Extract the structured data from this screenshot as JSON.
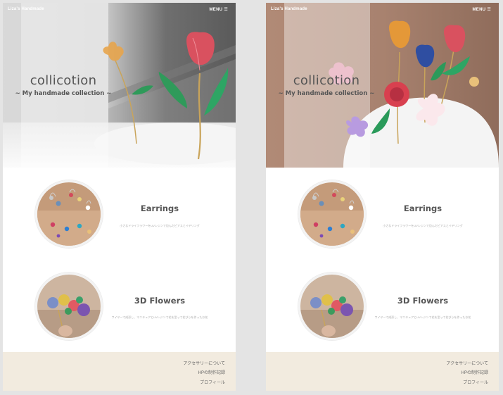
{
  "site_title": "Liza's Handmade",
  "menu_label": "MENU ☰",
  "hero": {
    "title": "collicotion",
    "subtitle": "~ My handmade collection ~"
  },
  "sections": [
    {
      "title": "Earrings",
      "description": "小さなドライフラワーをUVレジンで包んだピアスとイヤリング"
    },
    {
      "title": "3D Flowers",
      "description": "ワイヤーで成形し、マニキュアとUVレジンで花を型って花びらを作ったお花"
    }
  ],
  "footer_links": [
    "アクセサリーについて",
    "HPの制作記録",
    "プロフィール"
  ],
  "colors": {
    "footer_bg": "#f2ebdf",
    "background": "#e4e4e4",
    "text": "#555555"
  }
}
